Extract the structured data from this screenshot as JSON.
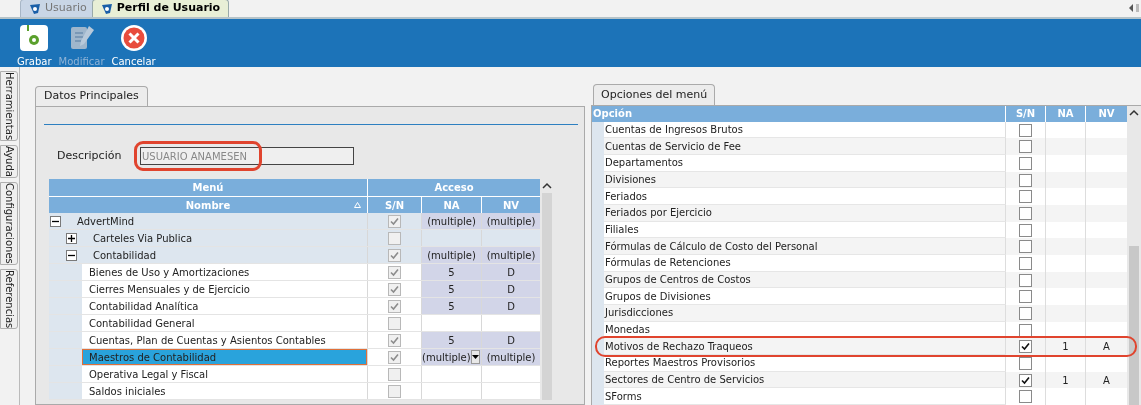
{
  "doc_tabs": [
    {
      "label": "Usuario",
      "selected": false
    },
    {
      "label": "Perfil de Usuario",
      "selected": true
    }
  ],
  "toolbar": [
    {
      "kind": "save",
      "label": "Grabar",
      "disabled": false
    },
    {
      "kind": "edit",
      "label": "Modificar",
      "disabled": true
    },
    {
      "kind": "cancel",
      "label": "Cancelar",
      "disabled": false
    }
  ],
  "side_tabs": [
    "Herramientas",
    "Ayuda",
    "Configuraciones",
    "Referencias"
  ],
  "main_panel": {
    "tab": "Datos Principales",
    "description": {
      "label": "Descripción",
      "value": "USUARIO ANAMESEN",
      "annotated": true
    },
    "grid": {
      "group_headers": [
        "Menú",
        "Acceso"
      ],
      "columns": [
        "Nombre",
        "S/N",
        "NA",
        "NV"
      ],
      "checkboxes_disabled": true,
      "rows": [
        {
          "name": "AdvertMind",
          "checked": true,
          "na": "(multiple)",
          "nv": "(multiple)",
          "expanded": true,
          "selected": false,
          "kind": "group",
          "children": [
            {
              "name": "Carteles Via Publica",
              "checked": false,
              "expanded": false,
              "selected": false,
              "kind": "group"
            },
            {
              "name": "Contabilidad",
              "checked": true,
              "na": "(multiple)",
              "nv": "(multiple)",
              "expanded": true,
              "selected": false,
              "kind": "group",
              "children": [
                {
                  "name": "Bienes de Uso y Amortizaciones",
                  "checked": true,
                  "na": "5",
                  "nv": "D",
                  "selected": false
                },
                {
                  "name": "Cierres Mensuales y de Ejercicio",
                  "checked": true,
                  "na": "5",
                  "nv": "D",
                  "selected": false
                },
                {
                  "name": "Contabilidad Analítica",
                  "checked": true,
                  "na": "5",
                  "nv": "D",
                  "selected": false
                },
                {
                  "name": "Contabilidad General",
                  "checked": false,
                  "selected": false
                },
                {
                  "name": "Cuentas, Plan de Cuentas y Asientos Contables",
                  "checked": true,
                  "na": "5",
                  "nv": "D",
                  "selected": false
                },
                {
                  "name": "Maestros de Contabilidad",
                  "checked": true,
                  "na": "(multiple)",
                  "nv": "(multiple)",
                  "selected": true
                },
                {
                  "name": "Operativa Legal y Fiscal",
                  "checked": false,
                  "selected": false
                },
                {
                  "name": "Saldos iniciales",
                  "checked": false,
                  "selected": false
                }
              ]
            }
          ]
        }
      ]
    }
  },
  "options_panel": {
    "tab": "Opciones del menú",
    "columns": [
      "Opción",
      "S/N",
      "NA",
      "NV"
    ],
    "rows": [
      {
        "label": "Cuentas de Ingresos Brutos",
        "checked": false,
        "annotated": false
      },
      {
        "label": "Cuentas de Servicio de Fee",
        "checked": false,
        "annotated": false
      },
      {
        "label": "Departamentos",
        "checked": false,
        "annotated": false
      },
      {
        "label": "Divisiones",
        "checked": false,
        "annotated": false
      },
      {
        "label": "Feriados",
        "checked": false,
        "annotated": false
      },
      {
        "label": "Feriados por Ejercicio",
        "checked": false,
        "annotated": false
      },
      {
        "label": "Filiales",
        "checked": false,
        "annotated": false
      },
      {
        "label": "Fórmulas de Cálculo de Costo del Personal",
        "checked": false,
        "annotated": false
      },
      {
        "label": "Fórmulas de Retenciones",
        "checked": false,
        "annotated": false
      },
      {
        "label": "Grupos de Centros de Costos",
        "checked": false,
        "annotated": false
      },
      {
        "label": "Grupos de Divisiones",
        "checked": false,
        "annotated": false
      },
      {
        "label": "Jurisdicciones",
        "checked": false,
        "annotated": false
      },
      {
        "label": "Monedas",
        "checked": false,
        "annotated": false
      },
      {
        "label": "Motivos de Rechazo Traqueos",
        "checked": true,
        "na": "1",
        "nv": "A",
        "annotated": true
      },
      {
        "label": "Reportes Maestros Provisorios",
        "checked": false,
        "annotated": false
      },
      {
        "label": "Sectores de Centro de Servicios",
        "checked": true,
        "na": "1",
        "nv": "A",
        "annotated": false
      },
      {
        "label": "SForms",
        "checked": false,
        "annotated": false
      }
    ]
  }
}
